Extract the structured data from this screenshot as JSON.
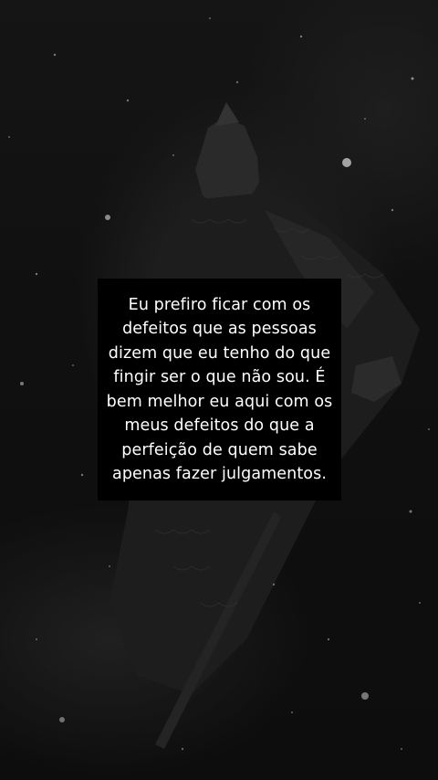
{
  "quote": {
    "text": "Eu prefiro ficar com os defeitos que as pessoas dizem que eu tenho do que fingir ser o que não sou. É bem melhor eu aqui com os meus defeitos do que a perfeição de quem sabe apenas fazer julgamentos."
  },
  "colors": {
    "background": "#111111",
    "box": "#000000",
    "text": "#ffffff"
  }
}
